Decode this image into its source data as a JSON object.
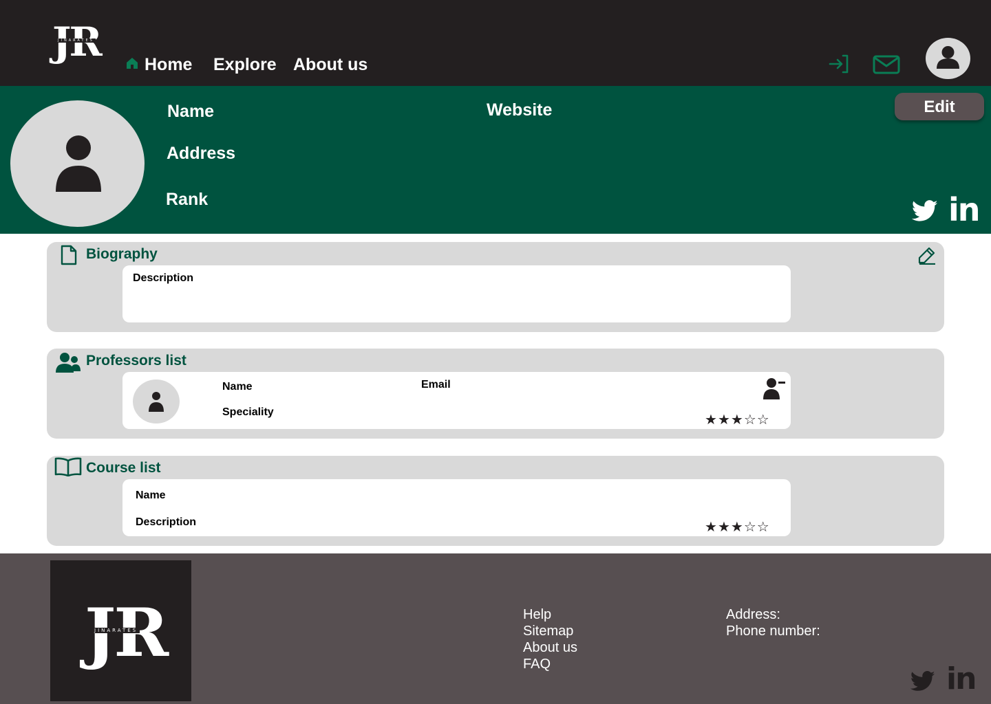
{
  "header": {
    "logo": {
      "letters": "JR",
      "subtitle": "JINARATES"
    },
    "nav": [
      {
        "label": "Home",
        "icon": "home-icon"
      },
      {
        "label": "Explore"
      },
      {
        "label": "About us"
      }
    ],
    "icons": [
      "login-icon",
      "mail-icon",
      "user-avatar-icon"
    ]
  },
  "profile": {
    "name_label": "Name",
    "address_label": "Address",
    "rank_label": "Rank",
    "website_label": "Website",
    "edit_label": "Edit",
    "social": [
      "twitter-icon",
      "linkedin-icon"
    ]
  },
  "biography": {
    "title": "Biography",
    "description_label": "Description"
  },
  "professors": {
    "title": "Professors list",
    "items": [
      {
        "name_label": "Name",
        "speciality_label": "Speciality",
        "email_label": "Email",
        "rating": 3,
        "rating_max": 5
      }
    ]
  },
  "courses": {
    "title": "Course list",
    "items": [
      {
        "name_label": "Name",
        "description_label": "Description",
        "rating": 3,
        "rating_max": 5
      }
    ]
  },
  "footer": {
    "logo": {
      "letters": "JR",
      "subtitle": "JINARATES"
    },
    "links": [
      "Help",
      "Sitemap",
      "About us",
      "FAQ"
    ],
    "contact": {
      "address_label": "Address:",
      "phone_label": "Phone number:"
    }
  },
  "colors": {
    "header_bg": "#231f20",
    "brand_green": "#00533f",
    "accent_green": "#0a7d55",
    "card_bg": "#d9d9d9",
    "footer_bg": "#574f51",
    "edit_button_bg": "#5a5052"
  }
}
